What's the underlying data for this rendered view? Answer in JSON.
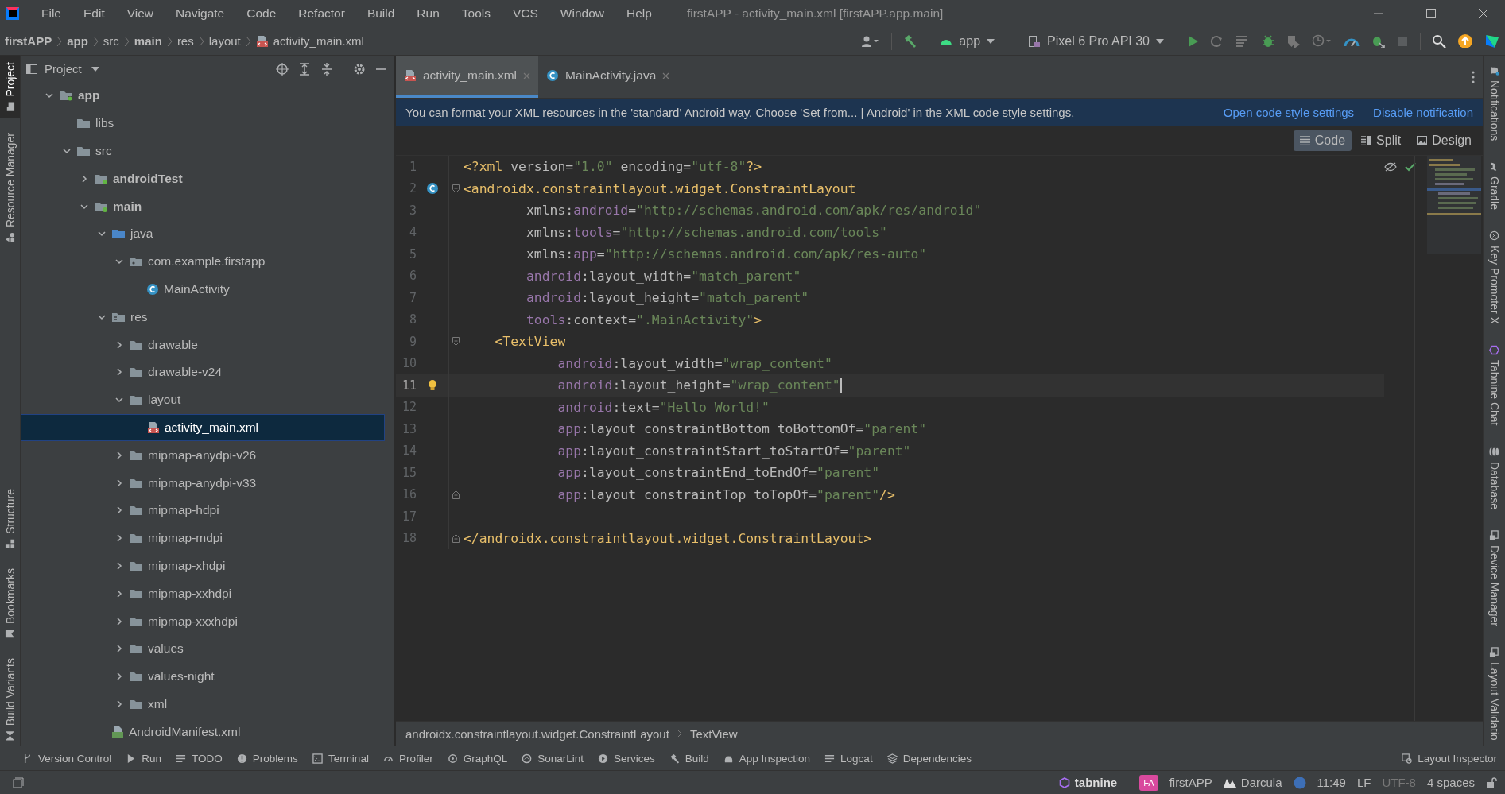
{
  "menu_bar": {
    "items": [
      "File",
      "Edit",
      "View",
      "Navigate",
      "Code",
      "Refactor",
      "Build",
      "Run",
      "Tools",
      "VCS",
      "Window",
      "Help"
    ],
    "title": "firstAPP - activity_main.xml [firstAPP.app.main]"
  },
  "breadcrumb": [
    {
      "label": "firstAPP",
      "bold": true
    },
    {
      "label": "app",
      "bold": true
    },
    {
      "label": "src",
      "bold": false
    },
    {
      "label": "main",
      "bold": true
    },
    {
      "label": "res",
      "bold": false
    },
    {
      "label": "layout",
      "bold": false
    },
    {
      "label": "activity_main.xml",
      "bold": false,
      "kind": "layout-file"
    }
  ],
  "run_config": {
    "module": "app",
    "device": "Pixel 6 Pro API 30"
  },
  "left_tool_strip": [
    {
      "label": "Project",
      "selected": true,
      "kind": "project"
    },
    {
      "label": "Resource Manager",
      "selected": false,
      "kind": "resources"
    },
    {
      "label": "Structure",
      "selected": false,
      "kind": "structure"
    },
    {
      "label": "Bookmarks",
      "selected": false,
      "kind": "bookmarks"
    },
    {
      "label": "Build Variants",
      "selected": false,
      "kind": "variants"
    }
  ],
  "project": {
    "title": "Project",
    "tree": [
      {
        "label": "app",
        "kind": "module",
        "expanded": true,
        "selected": false,
        "children": [
          {
            "label": "libs",
            "kind": "folder",
            "selected": false
          },
          {
            "label": "src",
            "kind": "folder",
            "expanded": true,
            "selected": false,
            "children": [
              {
                "label": "androidTest",
                "kind": "source-root",
                "expanded": false,
                "selected": false
              },
              {
                "label": "main",
                "kind": "source-root",
                "expanded": true,
                "selected": false,
                "children": [
                  {
                    "label": "java",
                    "kind": "java-folder",
                    "expanded": true,
                    "selected": false,
                    "children": [
                      {
                        "label": "com.example.firstapp",
                        "kind": "package",
                        "expanded": true,
                        "selected": false,
                        "children": [
                          {
                            "label": "MainActivity",
                            "kind": "class",
                            "selected": false
                          }
                        ]
                      }
                    ]
                  },
                  {
                    "label": "res",
                    "kind": "res-folder",
                    "expanded": true,
                    "selected": false,
                    "children": [
                      {
                        "label": "drawable",
                        "kind": "folder",
                        "expanded": false,
                        "selected": false
                      },
                      {
                        "label": "drawable-v24",
                        "kind": "folder",
                        "expanded": false,
                        "selected": false
                      },
                      {
                        "label": "layout",
                        "kind": "folder",
                        "expanded": true,
                        "selected": false,
                        "children": [
                          {
                            "label": "activity_main.xml",
                            "kind": "layout-file",
                            "selected": true
                          }
                        ]
                      },
                      {
                        "label": "mipmap-anydpi-v26",
                        "kind": "folder",
                        "expanded": false,
                        "selected": false
                      },
                      {
                        "label": "mipmap-anydpi-v33",
                        "kind": "folder",
                        "expanded": false,
                        "selected": false
                      },
                      {
                        "label": "mipmap-hdpi",
                        "kind": "folder",
                        "expanded": false,
                        "selected": false
                      },
                      {
                        "label": "mipmap-mdpi",
                        "kind": "folder",
                        "expanded": false,
                        "selected": false
                      },
                      {
                        "label": "mipmap-xhdpi",
                        "kind": "folder",
                        "expanded": false,
                        "selected": false
                      },
                      {
                        "label": "mipmap-xxhdpi",
                        "kind": "folder",
                        "expanded": false,
                        "selected": false
                      },
                      {
                        "label": "mipmap-xxxhdpi",
                        "kind": "folder",
                        "expanded": false,
                        "selected": false
                      },
                      {
                        "label": "values",
                        "kind": "folder",
                        "expanded": false,
                        "selected": false
                      },
                      {
                        "label": "values-night",
                        "kind": "folder",
                        "expanded": false,
                        "selected": false
                      },
                      {
                        "label": "xml",
                        "kind": "folder",
                        "expanded": false,
                        "selected": false
                      }
                    ]
                  },
                  {
                    "label": "AndroidManifest.xml",
                    "kind": "manifest",
                    "selected": false
                  }
                ]
              }
            ]
          }
        ]
      }
    ]
  },
  "editor": {
    "tabs": [
      {
        "label": "activity_main.xml",
        "kind": "layout-file",
        "selected": true
      },
      {
        "label": "MainActivity.java",
        "kind": "class",
        "selected": false
      }
    ],
    "banner": {
      "message": "You can format your XML resources in the 'standard' Android way. Choose 'Set from... | Android' in the XML code style settings.",
      "links": [
        "Open code style settings",
        "Disable notification"
      ]
    },
    "view_modes": [
      {
        "label": "Code",
        "kind": "code",
        "selected": true
      },
      {
        "label": "Split",
        "kind": "split",
        "selected": false
      },
      {
        "label": "Design",
        "kind": "design",
        "selected": false
      }
    ],
    "lines": [
      {
        "number": "1",
        "tokens": [
          {
            "kind": "tag",
            "text": "<?xml "
          },
          {
            "kind": "attr",
            "text": "version="
          },
          {
            "kind": "value",
            "text": "\"1.0\""
          },
          {
            "kind": "attr",
            "text": " encoding="
          },
          {
            "kind": "value",
            "text": "\"utf-8\""
          },
          {
            "kind": "tag",
            "text": "?>"
          }
        ]
      },
      {
        "number": "2",
        "gutter": {
          "kind": "class"
        },
        "fold": {
          "kind": "start"
        },
        "tokens": [
          {
            "kind": "tag",
            "text": "<androidx.constraintlayout.widget.ConstraintLayout"
          }
        ]
      },
      {
        "number": "3",
        "tokens": [
          {
            "kind": "attr",
            "text": "        xmlns:"
          },
          {
            "kind": "ns",
            "text": "android"
          },
          {
            "kind": "attr",
            "text": "="
          },
          {
            "kind": "value",
            "text": "\"http://schemas.android.com/apk/res/android\""
          }
        ]
      },
      {
        "number": "4",
        "tokens": [
          {
            "kind": "attr",
            "text": "        xmlns:"
          },
          {
            "kind": "ns",
            "text": "tools"
          },
          {
            "kind": "attr",
            "text": "="
          },
          {
            "kind": "value",
            "text": "\"http://schemas.android.com/tools\""
          }
        ]
      },
      {
        "number": "5",
        "tokens": [
          {
            "kind": "attr",
            "text": "        xmlns:"
          },
          {
            "kind": "ns",
            "text": "app"
          },
          {
            "kind": "attr",
            "text": "="
          },
          {
            "kind": "value",
            "text": "\"http://schemas.android.com/apk/res-auto\""
          }
        ]
      },
      {
        "number": "6",
        "tokens": [
          {
            "kind": "ns",
            "text": "        android"
          },
          {
            "kind": "attr",
            "text": ":layout_width="
          },
          {
            "kind": "value",
            "text": "\"match_parent\""
          }
        ]
      },
      {
        "number": "7",
        "tokens": [
          {
            "kind": "ns",
            "text": "        android"
          },
          {
            "kind": "attr",
            "text": ":layout_height="
          },
          {
            "kind": "value",
            "text": "\"match_parent\""
          }
        ]
      },
      {
        "number": "8",
        "tokens": [
          {
            "kind": "ns",
            "text": "        tools"
          },
          {
            "kind": "attr",
            "text": ":context="
          },
          {
            "kind": "value",
            "text": "\".MainActivity\""
          },
          {
            "kind": "tag",
            "text": ">"
          }
        ]
      },
      {
        "number": "9",
        "fold": {
          "kind": "start"
        },
        "tokens": [
          {
            "kind": "tag",
            "text": "    <TextView"
          }
        ]
      },
      {
        "number": "10",
        "tokens": [
          {
            "kind": "ns",
            "text": "            android"
          },
          {
            "kind": "attr",
            "text": ":layout_width="
          },
          {
            "kind": "value",
            "text": "\"wrap_content\""
          }
        ]
      },
      {
        "number": "11",
        "gutter": {
          "kind": "bulb"
        },
        "current": true,
        "tokens": [
          {
            "kind": "ns",
            "text": "            android"
          },
          {
            "kind": "attr",
            "text": ":layout_height="
          },
          {
            "kind": "value",
            "text": "\"wrap_content\""
          }
        ]
      },
      {
        "number": "12",
        "tokens": [
          {
            "kind": "ns",
            "text": "            android"
          },
          {
            "kind": "attr",
            "text": ":text="
          },
          {
            "kind": "value",
            "text": "\"Hello World!\""
          }
        ]
      },
      {
        "number": "13",
        "tokens": [
          {
            "kind": "ns",
            "text": "            app"
          },
          {
            "kind": "attr",
            "text": ":layout_constraintBottom_toBottomOf="
          },
          {
            "kind": "value",
            "text": "\"parent\""
          }
        ]
      },
      {
        "number": "14",
        "tokens": [
          {
            "kind": "ns",
            "text": "            app"
          },
          {
            "kind": "attr",
            "text": ":layout_constraintStart_toStartOf="
          },
          {
            "kind": "value",
            "text": "\"parent\""
          }
        ]
      },
      {
        "number": "15",
        "tokens": [
          {
            "kind": "ns",
            "text": "            app"
          },
          {
            "kind": "attr",
            "text": ":layout_constraintEnd_toEndOf="
          },
          {
            "kind": "value",
            "text": "\"parent\""
          }
        ]
      },
      {
        "number": "16",
        "fold": {
          "kind": "end"
        },
        "tokens": [
          {
            "kind": "ns",
            "text": "            app"
          },
          {
            "kind": "attr",
            "text": ":layout_constraintTop_toTopOf="
          },
          {
            "kind": "value",
            "text": "\"parent\""
          },
          {
            "kind": "tag",
            "text": "/>"
          }
        ]
      },
      {
        "number": "17"
      },
      {
        "number": "18",
        "fold": {
          "kind": "end"
        },
        "tokens": [
          {
            "kind": "tag",
            "text": "</androidx.constraintlayout.widget.ConstraintLayout>"
          }
        ]
      }
    ],
    "breadcrumb": [
      "androidx.constraintlayout.widget.ConstraintLayout",
      "TextView"
    ]
  },
  "right_tool_strip": [
    {
      "label": "Notifications",
      "kind": "bell"
    },
    {
      "label": "Gradle",
      "kind": "gradle"
    },
    {
      "label": "Key Promoter X",
      "kind": "key"
    },
    {
      "label": "Tabnine Chat",
      "kind": "hexagon"
    },
    {
      "label": "Database",
      "kind": "database"
    },
    {
      "label": "Device Manager",
      "kind": "device"
    },
    {
      "label": "Layout Validatio",
      "kind": "device"
    }
  ],
  "tool_windows": [
    {
      "label": "Version Control",
      "kind": "branch"
    },
    {
      "label": "Run",
      "kind": "run"
    },
    {
      "label": "TODO",
      "kind": "list"
    },
    {
      "label": "Problems",
      "kind": "alert"
    },
    {
      "label": "Terminal",
      "kind": "terminal"
    },
    {
      "label": "Profiler",
      "kind": "gauge"
    },
    {
      "label": "GraphQL",
      "kind": "gear"
    },
    {
      "label": "SonarLint",
      "kind": "circle"
    },
    {
      "label": "Services",
      "kind": "run-circle"
    },
    {
      "label": "Build",
      "kind": "hammer"
    },
    {
      "label": "App Inspection",
      "kind": "android"
    },
    {
      "label": "Logcat",
      "kind": "list"
    },
    {
      "label": "Dependencies",
      "kind": "layers"
    }
  ],
  "layout_inspector": "Layout Inspector",
  "status_bar": {
    "tabnine": "tabnine",
    "project_badge": "FA",
    "project": "firstAPP",
    "theme": "Darcula",
    "position": "11:49",
    "line_separator": "LF",
    "encoding": "UTF-8",
    "indent": "4 spaces"
  }
}
